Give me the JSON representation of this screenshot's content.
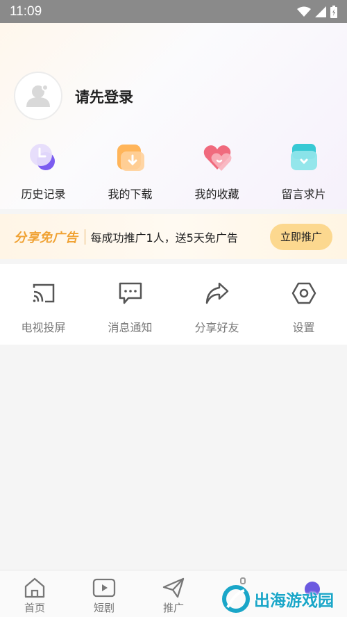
{
  "status_bar": {
    "time": "11:09"
  },
  "profile": {
    "login_prompt": "请先登录"
  },
  "quick_actions": [
    {
      "label": "历史记录",
      "icon": "history-icon"
    },
    {
      "label": "我的下载",
      "icon": "download-icon"
    },
    {
      "label": "我的收藏",
      "icon": "favorite-heart-icon"
    },
    {
      "label": "留言求片",
      "icon": "message-request-icon"
    }
  ],
  "promo": {
    "title": "分享免广告",
    "description": "每成功推广1人，送5天免广告",
    "button_label": "立即推广",
    "accent_color": "#f0a233"
  },
  "tools": [
    {
      "label": "电视投屏",
      "icon": "cast-icon"
    },
    {
      "label": "消息通知",
      "icon": "message-icon"
    },
    {
      "label": "分享好友",
      "icon": "share-icon"
    },
    {
      "label": "设置",
      "icon": "settings-icon"
    }
  ],
  "tabbar": [
    {
      "label": "首页",
      "icon": "home-icon"
    },
    {
      "label": "短剧",
      "icon": "play-icon"
    },
    {
      "label": "推广",
      "icon": "send-icon"
    }
  ],
  "watermark": {
    "text": "出海游戏园"
  }
}
